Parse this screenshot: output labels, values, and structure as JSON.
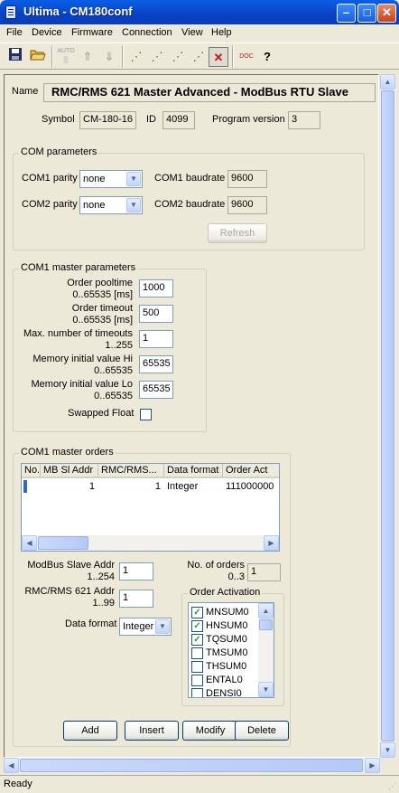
{
  "window": {
    "title": "Ultima - CM180conf"
  },
  "menu": [
    "File",
    "Device",
    "Firmware",
    "Connection",
    "View",
    "Help"
  ],
  "toolbar": {
    "auto_label": "AUTO",
    "doc_label": "DOC",
    "help_label": "?"
  },
  "header": {
    "name_label": "Name",
    "name_value": "RMC/RMS 621 Master Advanced - ModBus RTU Slave",
    "symbol_label": "Symbol",
    "symbol_value": "CM-180-16",
    "id_label": "ID",
    "id_value": "4099",
    "program_version_label": "Program version",
    "program_version_value": "3"
  },
  "com_parameters": {
    "title": "COM parameters",
    "com1_parity_label": "COM1 parity",
    "com1_parity_value": "none",
    "com1_baudrate_label": "COM1 baudrate",
    "com1_baudrate_value": "9600",
    "com2_parity_label": "COM2 parity",
    "com2_parity_value": "none",
    "com2_baudrate_label": "COM2 baudrate",
    "com2_baudrate_value": "9600",
    "refresh_label": "Refresh"
  },
  "master_parameters": {
    "title": "COM1 master parameters",
    "order_pooltime_label": "Order pooltime",
    "order_pooltime_range": "0..65535 [ms]",
    "order_pooltime_value": "1000",
    "order_timeout_label": "Order timeout",
    "order_timeout_range": "0..65535 [ms]",
    "order_timeout_value": "500",
    "max_timeouts_label": "Max. number of timeouts",
    "max_timeouts_range": "1..255",
    "max_timeouts_value": "1",
    "mem_hi_label": "Memory initial value Hi",
    "mem_hi_range": "0..65535",
    "mem_hi_value": "65535",
    "mem_lo_label": "Memory initial value Lo",
    "mem_lo_range": "0..65535",
    "mem_lo_value": "65535",
    "swapped_float_label": "Swapped Float",
    "swapped_float_checked": false
  },
  "master_orders": {
    "title": "COM1 master orders",
    "columns": [
      "No.",
      "MB Sl Addr",
      "RMC/RMS...",
      "Data format",
      "Order Act"
    ],
    "rows": [
      {
        "no": "",
        "mb_sl_addr": "1",
        "rmc_rms": "1",
        "data_format": "Integer",
        "order_act": "111000000"
      }
    ],
    "modbus_slave_addr_label": "ModBus Slave Addr",
    "modbus_slave_addr_range": "1..254",
    "modbus_slave_addr_value": "1",
    "no_of_orders_label": "No. of orders",
    "no_of_orders_range": "0..3",
    "no_of_orders_value": "1",
    "rmc_addr_label": "RMC/RMS 621 Addr",
    "rmc_addr_range": "1..99",
    "rmc_addr_value": "1",
    "data_format_label": "Data format",
    "data_format_value": "Integer",
    "order_activation_title": "Order Activation",
    "order_activation_items": [
      {
        "label": "MNSUM0",
        "checked": true
      },
      {
        "label": "HNSUM0",
        "checked": true
      },
      {
        "label": "TQSUM0",
        "checked": true
      },
      {
        "label": "TMSUM0",
        "checked": false
      },
      {
        "label": "THSUM0",
        "checked": false
      },
      {
        "label": "ENTAL0",
        "checked": false
      },
      {
        "label": "DENSI0",
        "checked": false
      }
    ],
    "add_label": "Add",
    "insert_label": "Insert",
    "modify_label": "Modify",
    "delete_label": "Delete"
  },
  "status": {
    "text": "Ready"
  }
}
